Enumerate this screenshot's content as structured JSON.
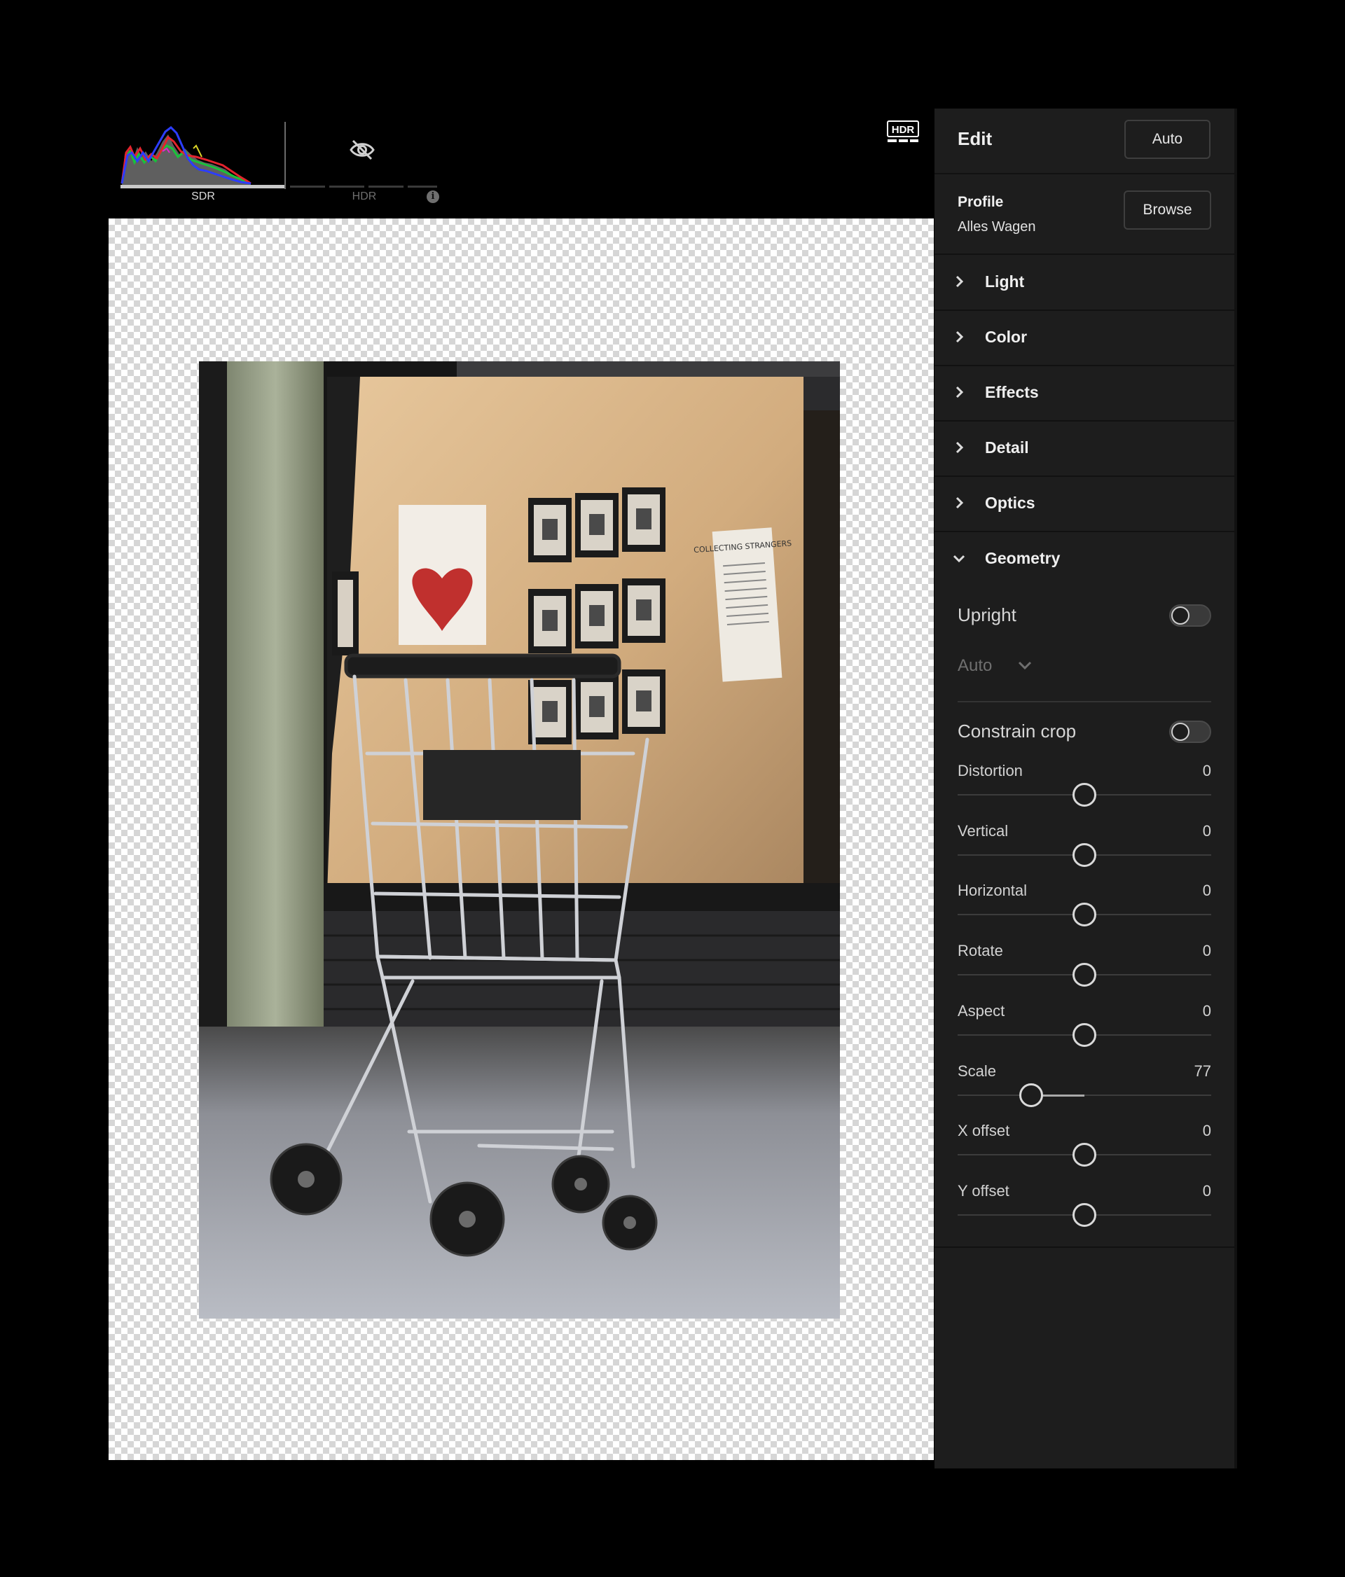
{
  "histogram": {
    "sdr_label": "SDR",
    "hdr_label": "HDR",
    "info_icon": "i",
    "hidden_icon": "eye-off-icon"
  },
  "hdr_badge": "HDR",
  "photo": {
    "description_icon": "photo",
    "sign_text": "COLLECTING STRANGERS"
  },
  "panel": {
    "title": "Edit",
    "auto_label": "Auto",
    "profile": {
      "label": "Profile",
      "value": "Alles Wagen",
      "browse_label": "Browse"
    },
    "sections": [
      {
        "label": "Light",
        "expanded": false
      },
      {
        "label": "Color",
        "expanded": false
      },
      {
        "label": "Effects",
        "expanded": false
      },
      {
        "label": "Detail",
        "expanded": false
      },
      {
        "label": "Optics",
        "expanded": false
      },
      {
        "label": "Geometry",
        "expanded": true
      }
    ],
    "geometry": {
      "upright_label": "Upright",
      "upright_on": false,
      "upright_mode": "Auto",
      "constrain_label": "Constrain crop",
      "constrain_on": false,
      "sliders": [
        {
          "label": "Distortion",
          "value": "0",
          "fraction": 0.5
        },
        {
          "label": "Vertical",
          "value": "0",
          "fraction": 0.5
        },
        {
          "label": "Horizontal",
          "value": "0",
          "fraction": 0.5
        },
        {
          "label": "Rotate",
          "value": "0",
          "fraction": 0.5
        },
        {
          "label": "Aspect",
          "value": "0",
          "fraction": 0.5
        },
        {
          "label": "Scale",
          "value": "77",
          "fraction": 0.29
        },
        {
          "label": "X offset",
          "value": "0",
          "fraction": 0.5
        },
        {
          "label": "Y offset",
          "value": "0",
          "fraction": 0.5
        }
      ]
    }
  }
}
